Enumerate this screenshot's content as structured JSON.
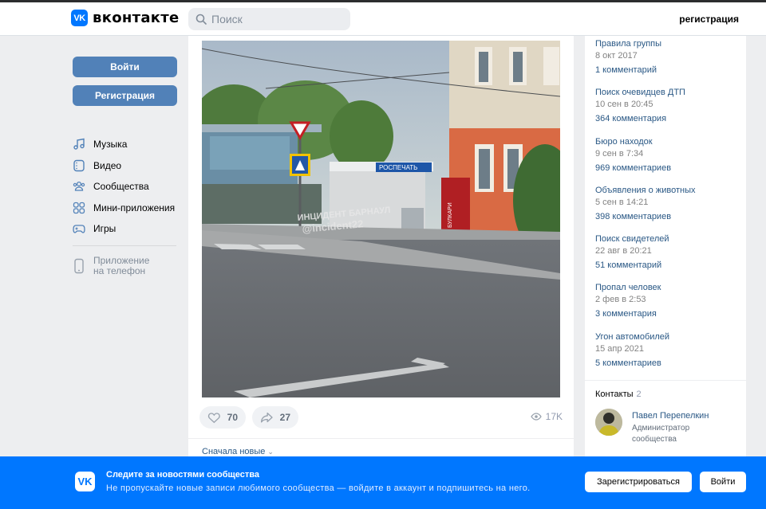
{
  "header": {
    "logo_mark": "VK",
    "logo_text": "вконтакте",
    "search_placeholder": "Поиск",
    "register_link": "регистрация"
  },
  "sidebar": {
    "login_button": "Войти",
    "register_button": "Регистрация",
    "items": [
      {
        "label": "Музыка",
        "icon": "music-icon"
      },
      {
        "label": "Видео",
        "icon": "video-icon"
      },
      {
        "label": "Сообщества",
        "icon": "communities-icon"
      },
      {
        "label": "Мини-приложения",
        "icon": "mini-apps-icon"
      },
      {
        "label": "Игры",
        "icon": "gamepad-icon"
      }
    ],
    "app_promo": "Приложение на телефон"
  },
  "post": {
    "photo_watermark": "ИНЦИДЕНТ БАРНАУЛ @incident22",
    "likes": "70",
    "shares": "27",
    "views": "17K"
  },
  "comments": {
    "sort_label": "Сначала новые"
  },
  "topics": [
    {
      "title": "Правила группы",
      "date": "8 окт 2017",
      "comments": "1 комментарий"
    },
    {
      "title": "Поиск очевидцев ДТП",
      "date": "10 сен в 20:45",
      "comments": "364 комментария"
    },
    {
      "title": "Бюро находок",
      "date": "9 сен в 7:34",
      "comments": "969 комментариев"
    },
    {
      "title": "Объявления о животных",
      "date": "5 сен в 14:21",
      "comments": "398 комментариев"
    },
    {
      "title": "Поиск свидетелей",
      "date": "22 авг в 20:21",
      "comments": "51 комментарий"
    },
    {
      "title": "Пропал человек",
      "date": "2 фев в 2:53",
      "comments": "3 комментария"
    },
    {
      "title": "Угон автомобилей",
      "date": "15 апр 2021",
      "comments": "5 комментариев"
    }
  ],
  "contacts": {
    "title": "Контакты",
    "count": "2",
    "name": "Павел Перепелкин",
    "role": "Администратор сообщества"
  },
  "banner": {
    "title": "Следите за новостями сообщества",
    "subtitle": "Не пропускайте новые записи любимого сообщества — войдите в аккаунт и подпишитесь на него.",
    "register_button": "Зарегистрироваться",
    "login_button": "Войти"
  },
  "colors": {
    "accent": "#0077ff",
    "button": "#5181b8",
    "link": "#2a5885"
  }
}
